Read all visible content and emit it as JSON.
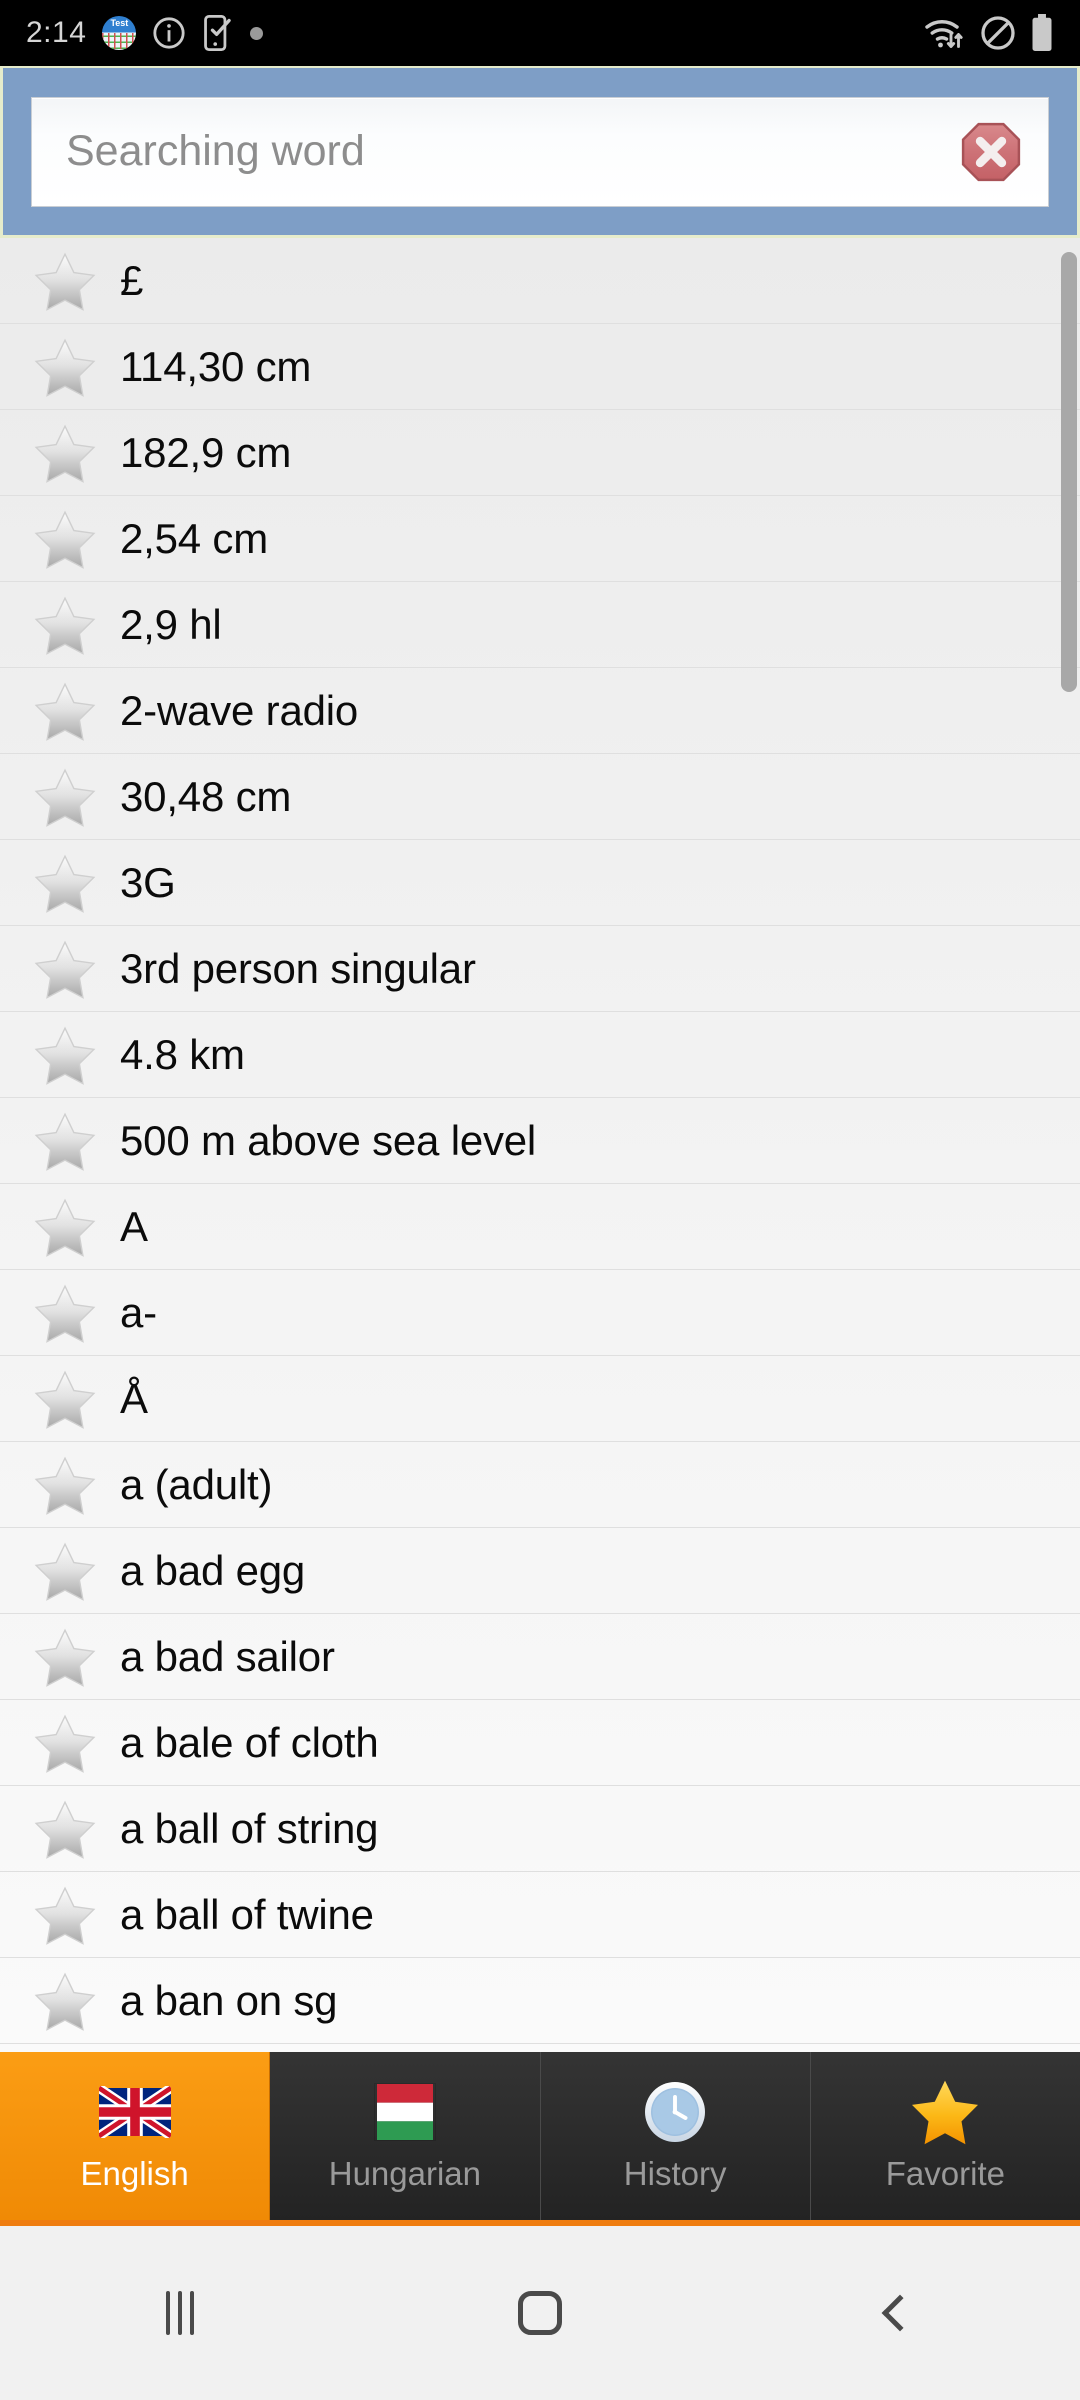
{
  "status_bar": {
    "time": "2:14",
    "left_icons": [
      {
        "name": "test-app-icon",
        "label": "Test"
      },
      {
        "name": "info-icon"
      },
      {
        "name": "phone-check-icon"
      },
      {
        "name": "dot-indicator-icon"
      }
    ],
    "right_icons": [
      {
        "name": "wifi-transfer-icon"
      },
      {
        "name": "do-not-disturb-icon"
      },
      {
        "name": "battery-icon"
      }
    ]
  },
  "search": {
    "placeholder": "Searching word",
    "value": "",
    "clear_label": "",
    "bar_color": "#7e9ec6",
    "clear_color": "#cb6d72"
  },
  "list": {
    "items": [
      {
        "word": "£",
        "favorite": false
      },
      {
        "word": "114,30 cm",
        "favorite": false
      },
      {
        "word": "182,9 cm",
        "favorite": false
      },
      {
        "word": "2,54 cm",
        "favorite": false
      },
      {
        "word": "2,9 hl",
        "favorite": false
      },
      {
        "word": "2-wave radio",
        "favorite": false
      },
      {
        "word": "30,48 cm",
        "favorite": false
      },
      {
        "word": "3G",
        "favorite": false
      },
      {
        "word": "3rd person singular",
        "favorite": false
      },
      {
        "word": "4.8 km",
        "favorite": false
      },
      {
        "word": "500 m above sea level",
        "favorite": false
      },
      {
        "word": "A",
        "favorite": false
      },
      {
        "word": "a-",
        "favorite": false
      },
      {
        "word": "Å",
        "favorite": false
      },
      {
        "word": "a (adult)",
        "favorite": false
      },
      {
        "word": "a bad egg",
        "favorite": false
      },
      {
        "word": "a bad sailor",
        "favorite": false
      },
      {
        "word": "a bale of cloth",
        "favorite": false
      },
      {
        "word": "a ball of string",
        "favorite": false
      },
      {
        "word": "a ball of twine",
        "favorite": false
      },
      {
        "word": "a ban on sg",
        "favorite": false
      }
    ]
  },
  "tabs": [
    {
      "label": "English",
      "icon": "uk-flag-icon",
      "active": true
    },
    {
      "label": "Hungarian",
      "icon": "hungary-flag-icon",
      "active": false
    },
    {
      "label": "History",
      "icon": "clock-icon",
      "active": false
    },
    {
      "label": "Favorite",
      "icon": "star-icon",
      "active": false
    }
  ],
  "tab_bar": {
    "accent_color": "#ef7d10"
  },
  "nav_bar": {
    "buttons": [
      {
        "name": "recents-button"
      },
      {
        "name": "home-button"
      },
      {
        "name": "back-button"
      }
    ]
  }
}
